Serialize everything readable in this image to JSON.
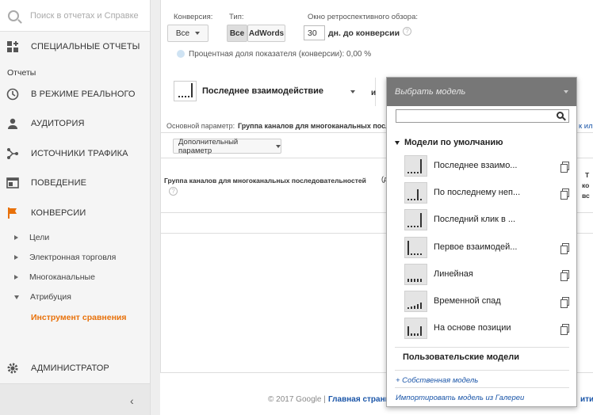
{
  "sidebar": {
    "search_placeholder": "Поиск в отчетах и Справке",
    "custom_reports": "СПЕЦИАЛЬНЫЕ ОТЧЕТЫ",
    "reports_header": "Отчеты",
    "realtime": "В РЕЖИМЕ РЕАЛЬНОГО",
    "audience": "АУДИТОРИЯ",
    "traffic": "ИСТОЧНИКИ ТРАФИКА",
    "behavior": "ПОВЕДЕНИЕ",
    "conversions": "КОНВЕРСИИ",
    "sub_items": [
      "Цели",
      "Электронная торговля",
      "Многоканальные",
      "Атрибуция"
    ],
    "active_item": "Инструмент сравнения",
    "admin": "АДМИНИСТРАТОР",
    "collapse": "‹"
  },
  "controls": {
    "conversion_label": "Конверсия:",
    "conversion_value": "Все",
    "type_label": "Тип:",
    "type_all": "Все",
    "type_adwords": "AdWords",
    "lookback_label": "Окно ретроспективного обзора:",
    "lookback_value": "30",
    "lookback_suffix": "дн. до конверсии",
    "help": "?",
    "percent_text": "Процентная доля показателя (конверсии): 0,00 %"
  },
  "model": {
    "selected": "Последнее взаимодействие",
    "and": "и",
    "choose_placeholder": "Выбрать модель"
  },
  "table": {
    "primary_label": "Основной параметр:",
    "primary_value": "Группа каналов для многоканальных последо",
    "right_link": "к или",
    "secondary_btn": "Дополнительный параметр",
    "col_header": "Группа каналов для многоканальных последовательностей",
    "col_header2": "(д",
    "right_col": "Т",
    "right_col2": "ко",
    "right_col3": "вс",
    "help": "?"
  },
  "footer": {
    "copyright": "© 2017 Google |",
    "home": "Главная страни",
    "right": "ити"
  },
  "dropdown": {
    "header": "Выбрать модель",
    "default_section": "Модели по умолчанию",
    "models": [
      {
        "name": "Последнее взаимо...",
        "copy": true
      },
      {
        "name": "По последнему неп...",
        "copy": true
      },
      {
        "name": "Последний клик в ...",
        "copy": false
      },
      {
        "name": "Первое взаимодей...",
        "copy": true
      },
      {
        "name": "Линейная",
        "copy": true
      },
      {
        "name": "Временной спад",
        "copy": true
      },
      {
        "name": "На основе позиции",
        "copy": true
      }
    ],
    "custom_section": "Пользовательские модели",
    "own_models_link": "+ Собственная модель",
    "import_link": "Импортировать модель из Галереи"
  }
}
